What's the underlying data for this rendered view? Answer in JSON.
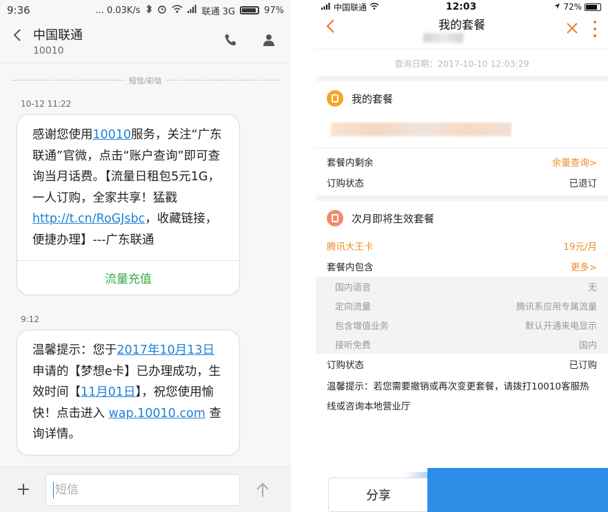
{
  "left": {
    "status": {
      "time": "9:36",
      "speed": "... 0.03K/s",
      "carrier": "联通 3G",
      "battery": "97%"
    },
    "header": {
      "contact_name": "中国联通",
      "contact_number": "10010"
    },
    "divider": "短信/彩信",
    "messages": [
      {
        "time": "10-12 11:22",
        "parts": [
          {
            "t": "感谢您使用"
          },
          {
            "t": "10010",
            "link": true
          },
          {
            "t": "服务，关注“广东联通”官微，点击“账户查询”即可查询当月话费。【流量日租包5元1G，一人订购，全家共享！猛戳"
          },
          {
            "t": "http://t.cn/RoGJsbc",
            "link": true
          },
          {
            "t": "，收藏链接，便捷办理】---广东联通"
          }
        ],
        "action": "流量充值"
      },
      {
        "time": "9:12",
        "parts": [
          {
            "t": "温馨提示：您于"
          },
          {
            "t": "2017年10月13日",
            "link": true
          },
          {
            "t": "申请的【梦想e卡】已办理成功，生效时间【"
          },
          {
            "t": "11月01日",
            "link": true
          },
          {
            "t": "】，祝您使用愉快！点击进入 "
          },
          {
            "t": "wap.10010.com",
            "link": true
          },
          {
            "t": " 查询详情。"
          }
        ]
      }
    ],
    "input": {
      "placeholder": "短信",
      "value": ""
    }
  },
  "right": {
    "status": {
      "carrier": "中国联通",
      "time": "12:03",
      "battery": "72%"
    },
    "nav": {
      "title": "我的套餐"
    },
    "query_date": "查询日期：2017-10-10 12:03:29",
    "section1": {
      "title": "我的套餐",
      "rows": [
        {
          "k": "套餐内剩余",
          "v": "余量查询>"
        },
        {
          "k": "订购状态",
          "v": "已退订"
        }
      ]
    },
    "section2": {
      "title": "次月即将生效套餐",
      "plan_name": "腾讯大王卡",
      "plan_price": "19元/月",
      "include_label": "套餐内包含",
      "include_more": "更多>",
      "sub_rows": [
        {
          "k": "国内语音",
          "v": "无"
        },
        {
          "k": "定向流量",
          "v": "腾讯系应用专属流量"
        },
        {
          "k": "包含增值业务",
          "v": "默认开通来电显示"
        },
        {
          "k": "接听免费",
          "v": "国内"
        }
      ],
      "status_label": "订购状态",
      "status_value": "已订购",
      "tip": "温馨提示：若您需要撤销或再次变更套餐，请拨打10010客服热线或咨询本地营业厅"
    },
    "share_button": "分享",
    "colors": {
      "accent": "#f07a2c",
      "link": "#1e80d8",
      "green": "#3aa846",
      "blue_panel": "#2e8ee8"
    }
  }
}
